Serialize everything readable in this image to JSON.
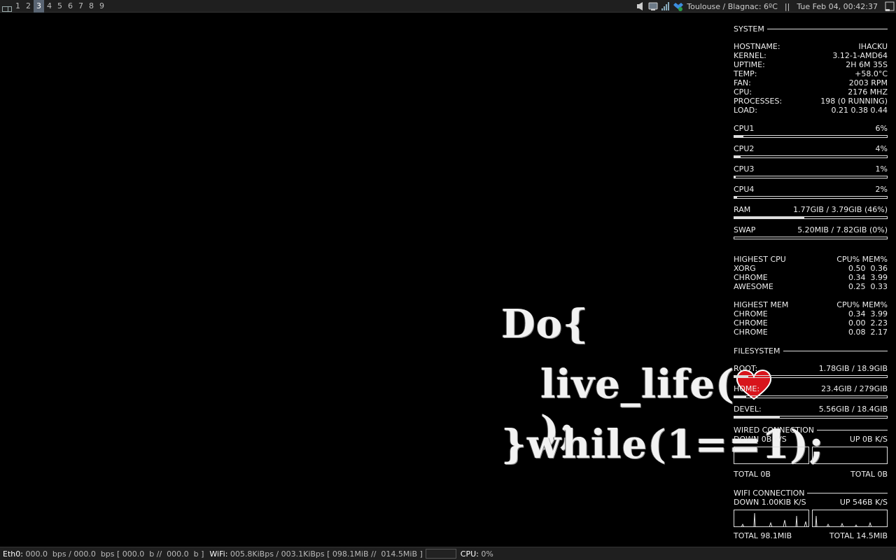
{
  "topbar": {
    "tags": [
      "1",
      "2",
      "3",
      "4",
      "5",
      "6",
      "7",
      "8",
      "9"
    ],
    "active_tag": "3",
    "icons": [
      "layout-icon",
      "volume-icon",
      "network-manager-icon",
      "signal-icon",
      "dropbox-icon"
    ],
    "weather": "Toulouse / Blagnac: 6ºC",
    "separator": "||",
    "datetime": "Tue Feb 04, 00:42:37"
  },
  "wallpaper": {
    "line1": "Do{",
    "line2": "live_life(",
    "line2_end": ");",
    "line3": "}while(1==1);"
  },
  "conky": {
    "system": {
      "heading": "SYSTEM",
      "rows": [
        {
          "label": "HOSTNAME:",
          "value": "IHACKU"
        },
        {
          "label": "KERNEL:",
          "value": "3.12-1-AMD64"
        },
        {
          "label": "UPTIME:",
          "value": "2H 6M 35S"
        },
        {
          "label": "TEMP:",
          "value": "+58.0°C"
        },
        {
          "label": "FAN:",
          "value": "2003 RPM"
        },
        {
          "label": "CPU:",
          "value": "2176 MHZ"
        },
        {
          "label": "PROCESSES:",
          "value": "198 (0 RUNNING)"
        },
        {
          "label": "LOAD:",
          "value": "0.21 0.38 0.44"
        }
      ]
    },
    "cpus": [
      {
        "label": "CPU1",
        "value": "6%",
        "level": 6
      },
      {
        "label": "CPU2",
        "value": "4%",
        "level": 4
      },
      {
        "label": "CPU3",
        "value": "1%",
        "level": 1
      },
      {
        "label": "CPU4",
        "value": "2%",
        "level": 2
      }
    ],
    "memory": [
      {
        "label": "RAM",
        "value": "1.77GIB / 3.79GIB (46%)",
        "level": 46
      },
      {
        "label": "SWAP",
        "value": "5.20MIB / 7.82GIB (0%)",
        "level": 0
      }
    ],
    "highest_cpu": {
      "heading": "HIGHEST CPU",
      "cols": "CPU% MEM%",
      "rows": [
        {
          "name": "XORG",
          "value": "0.50  0.36"
        },
        {
          "name": "CHROME",
          "value": "0.34  3.99"
        },
        {
          "name": "AWESOME",
          "value": "0.25  0.33"
        }
      ]
    },
    "highest_mem": {
      "heading": "HIGHEST MEM",
      "cols": "CPU% MEM%",
      "rows": [
        {
          "name": "CHROME",
          "value": "0.34  3.99"
        },
        {
          "name": "CHROME",
          "value": "0.00  2.23"
        },
        {
          "name": "CHROME",
          "value": "0.08  2.17"
        }
      ]
    },
    "filesystem": {
      "heading": "FILESYSTEM",
      "rows": [
        {
          "label": "ROOT:",
          "value": "1.78GIB / 18.9GIB",
          "level": 9
        },
        {
          "label": "HOME:",
          "value": "23.4GIB / 279GIB",
          "level": 8
        },
        {
          "label": "DEVEL:",
          "value": "5.56GIB / 18.4GIB",
          "level": 30
        }
      ]
    },
    "wired": {
      "heading": "WIRED CONNECTION",
      "down": "DOWN 0B   K/S",
      "up": "UP 0B    K/S",
      "total_down": "TOTAL 0B",
      "total_up": "TOTAL 0B"
    },
    "wifi": {
      "heading": "WIFI CONNECTION",
      "down": "DOWN 1.00KIB K/S",
      "up": "UP 546B   K/S",
      "total_down": "TOTAL 98.1MIB",
      "total_up": "TOTAL 14.5MIB"
    }
  },
  "bottombar": {
    "eth_label": "Eth0:",
    "eth_value": " 000.0  bps / 000.0  bps [ 000.0  b //  000.0  b ]",
    "wifi_label": "WiFi:",
    "wifi_value": " 005.8KiBps / 003.1KiBps [ 098.1MiB //  014.5MiB ]",
    "cpu_label": "CPU:",
    "cpu_value": " 0%"
  },
  "colors": {
    "heart": "#d8141c",
    "bar": "#1f1f1f",
    "active_tag": "#5a6573"
  }
}
